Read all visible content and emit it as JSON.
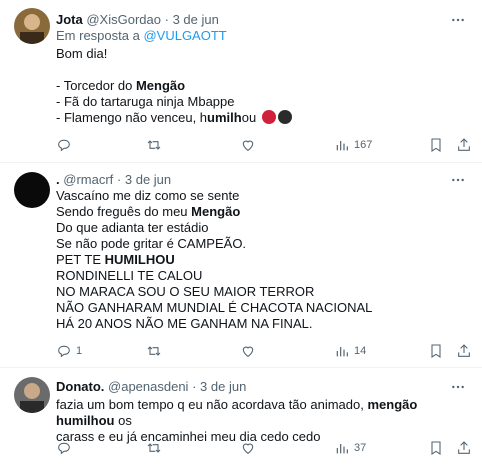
{
  "tweets": [
    {
      "name": "Jota",
      "handle": "@XisGordao",
      "sep": "·",
      "time": "3 de jun",
      "reply_prefix": "Em resposta a",
      "reply_mention": "@VULGAOTT",
      "lines": [
        "Bom dia!",
        "",
        "- Torcedor do ",
        "- Fã do tartaruga ninja Mbappe",
        "- Flamengo não venceu, h"
      ],
      "bold": [
        "Mengão",
        "umilhou"
      ],
      "tail": "ou",
      "avatar_color": "#8a6a3a",
      "emoji_colors": [
        "#d0203a",
        "#2b2b2b"
      ],
      "actions": {
        "reply": "",
        "retweet": "",
        "like": "",
        "views": "167"
      }
    },
    {
      "name": ".",
      "handle": "@rmacrf",
      "sep": "·",
      "time": "3 de jun",
      "lines": [
        "Vascaíno me diz como se sente",
        "Sendo freguês do meu ",
        "Do que adianta ter estádio",
        "Se não pode gritar é CAMPEÃO.",
        "PET TE ",
        "RONDINELLI TE CALOU",
        "NO MARACA SOU O SEU MAIOR TERROR",
        "NÃO GANHARAM MUNDIAL É CHACOTA NACIONAL",
        "HÁ 20 ANOS NÃO ME GANHAM NA FINAL."
      ],
      "bold": [
        "Mengão",
        "HUMILHOU"
      ],
      "avatar_color": "#0a0a0a",
      "actions": {
        "reply": "1",
        "retweet": "",
        "like": "",
        "views": "14"
      }
    },
    {
      "name": "Donato.",
      "handle": "@apenasdeni",
      "sep": "·",
      "time": "3 de jun",
      "line1_pre": "fazia um bom tempo q eu não acordava tão animado, ",
      "line1_bold": "mengão humilhou",
      "line1_post": " os",
      "line2": "carass e eu já encaminhei meu dia cedo cedo",
      "avatar_color": "#6b6b6b",
      "actions": {
        "reply": "",
        "retweet": "",
        "like": "",
        "views": "37"
      }
    }
  ]
}
